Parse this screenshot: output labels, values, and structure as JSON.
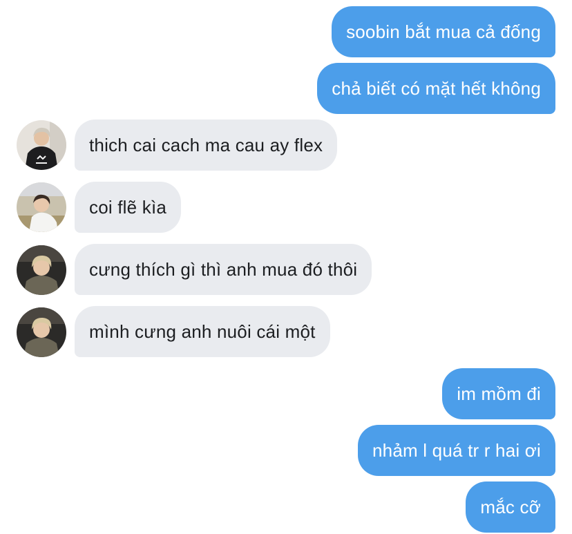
{
  "messages": [
    {
      "id": "m1",
      "side": "sent",
      "text": "soobin bắt mua cả đống"
    },
    {
      "id": "m2",
      "side": "sent",
      "text": "chả biết có mặt hết không"
    },
    {
      "id": "m3",
      "side": "received",
      "text": "thich cai cach ma cau ay flex",
      "avatar": "avatar-hoodie-photo"
    },
    {
      "id": "m4",
      "side": "received",
      "text": "coi flẽ kìa",
      "avatar": "avatar-white-hoodie-photo"
    },
    {
      "id": "m5",
      "side": "received",
      "text": "cưng thích gì thì anh mua đó thôi",
      "avatar": "avatar-blond-photo"
    },
    {
      "id": "m6",
      "side": "received",
      "text": "mình cưng anh nuôi cái một",
      "avatar": "avatar-blond-photo"
    },
    {
      "id": "m7",
      "side": "sent",
      "text": "im mồm đi"
    },
    {
      "id": "m8",
      "side": "sent",
      "text": "nhảm l quá tr r hai ơi"
    },
    {
      "id": "m9",
      "side": "sent",
      "text": "mắc cỡ"
    }
  ],
  "colors": {
    "sent_bubble": "#4c9eea",
    "received_bubble": "#e9ebef",
    "received_text": "#1c1e21",
    "background": "#ffffff"
  }
}
